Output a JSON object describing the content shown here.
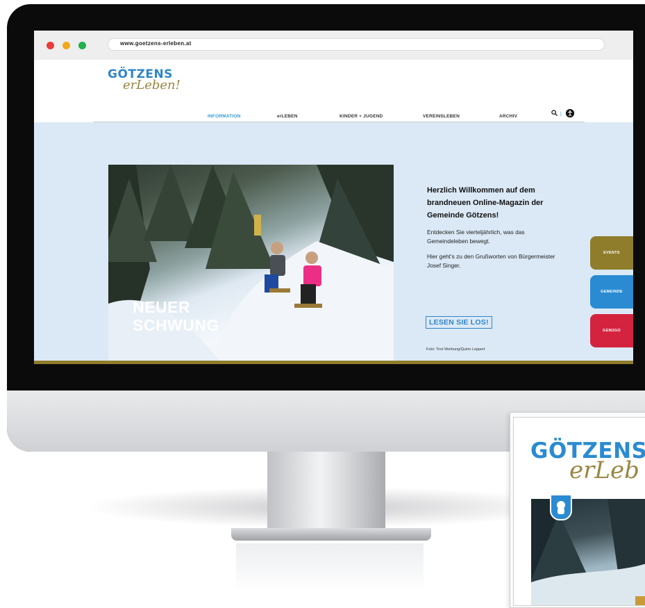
{
  "browser": {
    "url": "www.goetzens-erleben.at"
  },
  "site": {
    "logo_main": "GÖTZENS",
    "logo_script": "erLeben!",
    "nav": [
      {
        "label": "INFORMATION"
      },
      {
        "label": "erLEBEN"
      },
      {
        "label": "KINDER + JUGEND"
      },
      {
        "label": "VEREINSLEBEN"
      },
      {
        "label": "ARCHIV"
      }
    ],
    "nav_separator": "|",
    "search_icon": "search-icon",
    "accessibility_icon": "accessibility-icon"
  },
  "hero": {
    "title_line1": "NEUER",
    "title_line2": "SCHWUNG",
    "heading": "Herzlich Willkommen auf dem brandneuen Online-Magazin der Gemeinde Götzens!",
    "paragraph1": "Entdecken Sie vierteljährlich, was das Gemeindeleben bewegt.",
    "paragraph2": "Hier geht's zu den Grußworten von Bürgermeister Josef Singer.",
    "cta_label": "LESEN SIE LOS!",
    "photo_credit": "Foto: Tirol Werbung/Quirin Leppert"
  },
  "side_tabs": [
    {
      "label": "EVENTS",
      "color": "#8f7d2b"
    },
    {
      "label": "GEMEINDE",
      "color": "#2a8bd2"
    },
    {
      "label": "GEM2GO",
      "color": "#d4233e"
    }
  ],
  "magazine": {
    "logo_main": "GÖTZENS",
    "logo_script": "erLeb"
  },
  "colors": {
    "brand_blue": "#2a8bd2",
    "brand_gold": "#8f7d2b",
    "hero_background": "#dbe9f6"
  }
}
